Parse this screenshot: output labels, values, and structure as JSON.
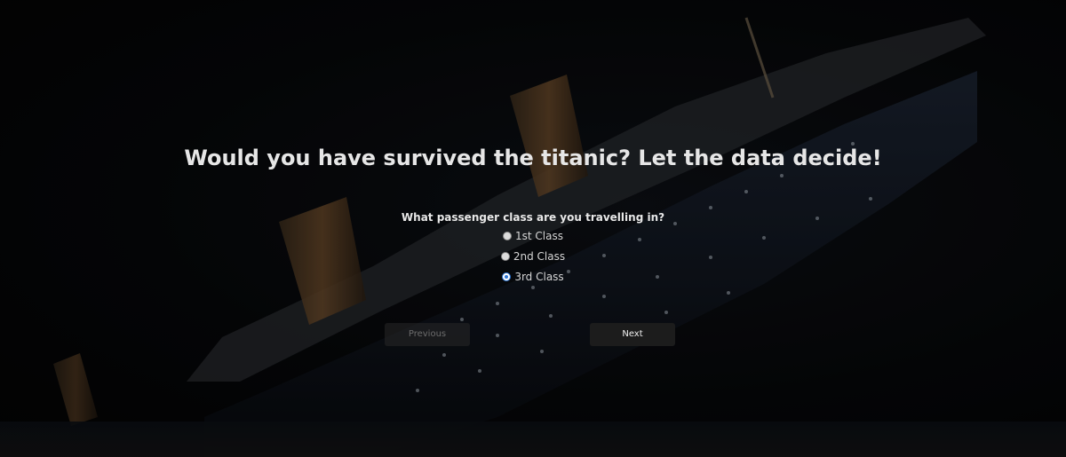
{
  "page": {
    "title": "Would you have survived the titanic? Let the data decide!"
  },
  "form": {
    "question": "What passenger class are you travelling in?",
    "options": [
      {
        "label": "1st Class",
        "selected": false
      },
      {
        "label": "2nd Class",
        "selected": false
      },
      {
        "label": "3rd Class",
        "selected": true
      }
    ],
    "previous_label": "Previous",
    "next_label": "Next",
    "previous_disabled": true
  },
  "colors": {
    "title_text": "#e6e6e6",
    "background": "#050505",
    "radio_accent": "#2f78d6",
    "next_button_bg": "#1c1c1c"
  }
}
